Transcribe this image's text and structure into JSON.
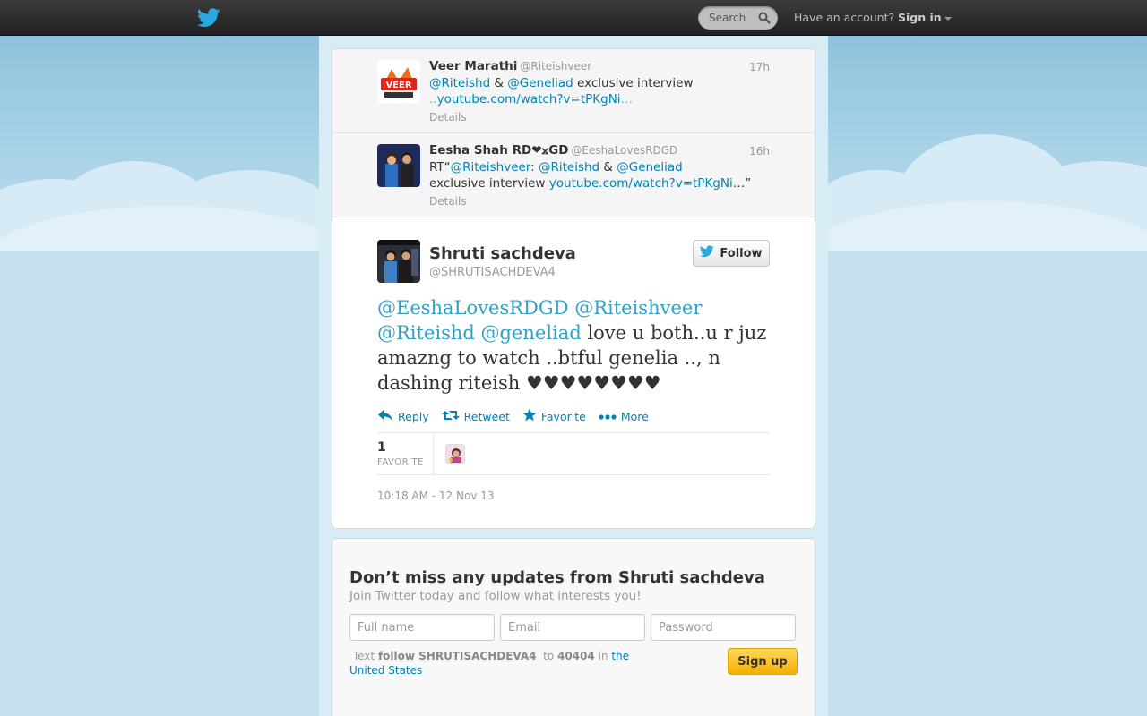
{
  "topbar": {
    "search_placeholder": "Search",
    "have_account": "Have an account?",
    "sign_in": "Sign in"
  },
  "context_tweets": [
    {
      "name": "Veer Marathi",
      "handle": "@Riteishveer",
      "time": "17h",
      "text_parts": {
        "m1": "@Riteishd",
        "amp": " & ",
        "m2": "@Geneliad",
        "rest": " exclusive interview",
        "link_pre": "..",
        "link": "youtube.com/watch?v=tPKgNi",
        "link_post": "…"
      },
      "details": "Details",
      "avatar_text": "VEER"
    },
    {
      "name": "Eesha Shah RD❤⨲GD",
      "handle": "@EeshaLovesRDGD",
      "time": "16h",
      "text_parts": {
        "rt": "RT“",
        "m0": "@Riteishveer",
        "colon": ": ",
        "m1": "@Riteishd",
        "amp": " & ",
        "m2": "@Geneliad",
        "rest": "exclusive interview",
        "link_pre": " ",
        "link": "youtube.com/watch?v=tPKgNi",
        "link_post": "…”"
      },
      "details": "Details"
    }
  ],
  "main_tweet": {
    "name": "Shruti sachdeva",
    "handle": "@SHRUTISACHDEVA4",
    "follow_label": "Follow",
    "mentions": [
      "@EeshaLovesRDGD",
      "@Riteishveer",
      "@Riteishd",
      "@geneliad"
    ],
    "text": " love u both..u r juz amazng to watch ..btful genelia .., n dashing riteish ♥♥♥♥♥♥♥♥",
    "actions": {
      "reply": "Reply",
      "retweet": "Retweet",
      "favorite": "Favorite",
      "more": "More"
    },
    "favorites_count": "1",
    "favorites_label": "FAVORITE",
    "timestamp": "10:18 AM - 12 Nov 13"
  },
  "signup": {
    "title": "Don’t miss any updates from Shruti sachdeva",
    "subtitle": "Join Twitter today and follow what interests you!",
    "full_name_placeholder": "Full name",
    "email_placeholder": "Email",
    "password_placeholder": "Password",
    "sms_text": "Text",
    "sms_command": "follow SHRUTISACHDEVA4",
    "sms_to": "to",
    "sms_number": "40404",
    "sms_in": "in",
    "sms_country": "the United States",
    "button": "Sign up"
  },
  "colors": {
    "link": "#0084b4",
    "twitter_blue": "#1da1f2",
    "sky": "#c0deed"
  }
}
